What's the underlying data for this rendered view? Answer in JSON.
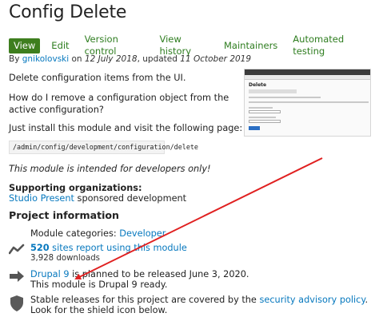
{
  "title": "Config Delete",
  "tabs": [
    "View",
    "Edit",
    "Version control",
    "View history",
    "Maintainers",
    "Automated testing"
  ],
  "byline": {
    "prefix": "By ",
    "author": "gnikolovski",
    "on": " on ",
    "created": "12 July 2018",
    "updated_prefix": ", updated ",
    "updated": "11 October 2019"
  },
  "body": {
    "p1": "Delete configuration items from the UI.",
    "p2": "How do I remove a configuration object from the active configuration?",
    "p3": "Just install this module and visit the following page:",
    "code": "/admin/config/development/configuration/delete",
    "p4": "This module is intended for developers only!"
  },
  "supporting": {
    "label": "Supporting organizations:",
    "org": "Studio Present",
    "suffix": " sponsored development"
  },
  "project_info": {
    "heading": "Project information",
    "categories_label": "Module categories: ",
    "category": "Developer",
    "usage_count": "520",
    "usage_text": " sites report using this module",
    "downloads": "3,928 downloads",
    "drupal9_link": "Drupal 9",
    "drupal9_text": " is planned to be released June 3, 2020.",
    "drupal9_ready": "This module is Drupal 9 ready.",
    "security_text": "Stable releases for this project are covered by the ",
    "security_link": "security advisory policy",
    "security_end": ".",
    "shield_hint": "Look for the shield icon below."
  },
  "screenshot_thumb": {
    "title": "Delete"
  },
  "colors": {
    "tab_active": "#3e7e1e",
    "tab_text": "#2e7d1f",
    "link": "#0678be",
    "annotation_arrow": "#e02020"
  },
  "icons": [
    "chart-icon",
    "arrow-right-icon",
    "shield-icon"
  ]
}
